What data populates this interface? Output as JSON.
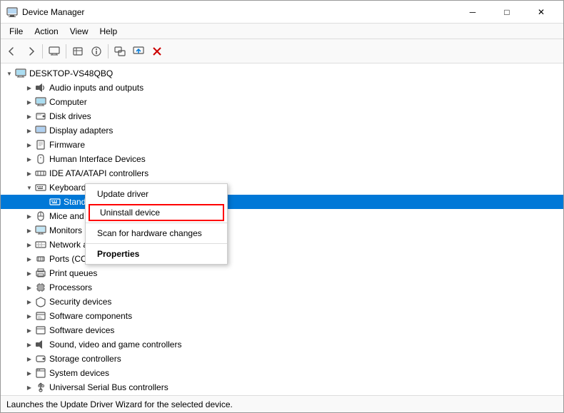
{
  "window": {
    "title": "Device Manager",
    "controls": {
      "minimize": "─",
      "maximize": "□",
      "close": "✕"
    }
  },
  "menu": {
    "items": [
      "File",
      "Action",
      "View",
      "Help"
    ]
  },
  "toolbar": {
    "buttons": [
      "←",
      "→",
      "🖥",
      "📋",
      "❓",
      "📄",
      "🖥",
      "📊",
      "✕"
    ]
  },
  "tree": {
    "root": "DESKTOP-VS48QBQ",
    "items": [
      {
        "label": "Audio inputs and outputs",
        "indent": 2,
        "expanded": false
      },
      {
        "label": "Computer",
        "indent": 2,
        "expanded": false
      },
      {
        "label": "Disk drives",
        "indent": 2,
        "expanded": false
      },
      {
        "label": "Display adapters",
        "indent": 2,
        "expanded": false
      },
      {
        "label": "Firmware",
        "indent": 2,
        "expanded": false
      },
      {
        "label": "Human Interface Devices",
        "indent": 2,
        "expanded": false
      },
      {
        "label": "IDE ATA/ATAPI controllers",
        "indent": 2,
        "expanded": false
      },
      {
        "label": "Keyboards",
        "indent": 2,
        "expanded": true
      },
      {
        "label": "Standard PS/2 Keyboard",
        "indent": 3,
        "expanded": false,
        "selected": true
      },
      {
        "label": "Mice and other pointing devices",
        "indent": 2,
        "expanded": false
      },
      {
        "label": "Monitors",
        "indent": 2,
        "expanded": false
      },
      {
        "label": "Network adapters",
        "indent": 2,
        "expanded": false
      },
      {
        "label": "Ports (COM & LPT)",
        "indent": 2,
        "expanded": false
      },
      {
        "label": "Print queues",
        "indent": 2,
        "expanded": false
      },
      {
        "label": "Processors",
        "indent": 2,
        "expanded": false
      },
      {
        "label": "Security devices",
        "indent": 2,
        "expanded": false
      },
      {
        "label": "Software components",
        "indent": 2,
        "expanded": false
      },
      {
        "label": "Software devices",
        "indent": 2,
        "expanded": false
      },
      {
        "label": "Sound, video and game controllers",
        "indent": 2,
        "expanded": false
      },
      {
        "label": "Storage controllers",
        "indent": 2,
        "expanded": false
      },
      {
        "label": "System devices",
        "indent": 2,
        "expanded": false
      },
      {
        "label": "Universal Serial Bus controllers",
        "indent": 2,
        "expanded": false
      }
    ]
  },
  "context_menu": {
    "items": [
      {
        "label": "Update driver",
        "type": "normal"
      },
      {
        "label": "Uninstall device",
        "type": "uninstall"
      },
      {
        "label": "Scan for hardware changes",
        "type": "normal"
      },
      {
        "label": "Properties",
        "type": "bold"
      }
    ]
  },
  "status_bar": {
    "text": "Launches the Update Driver Wizard for the selected device."
  }
}
